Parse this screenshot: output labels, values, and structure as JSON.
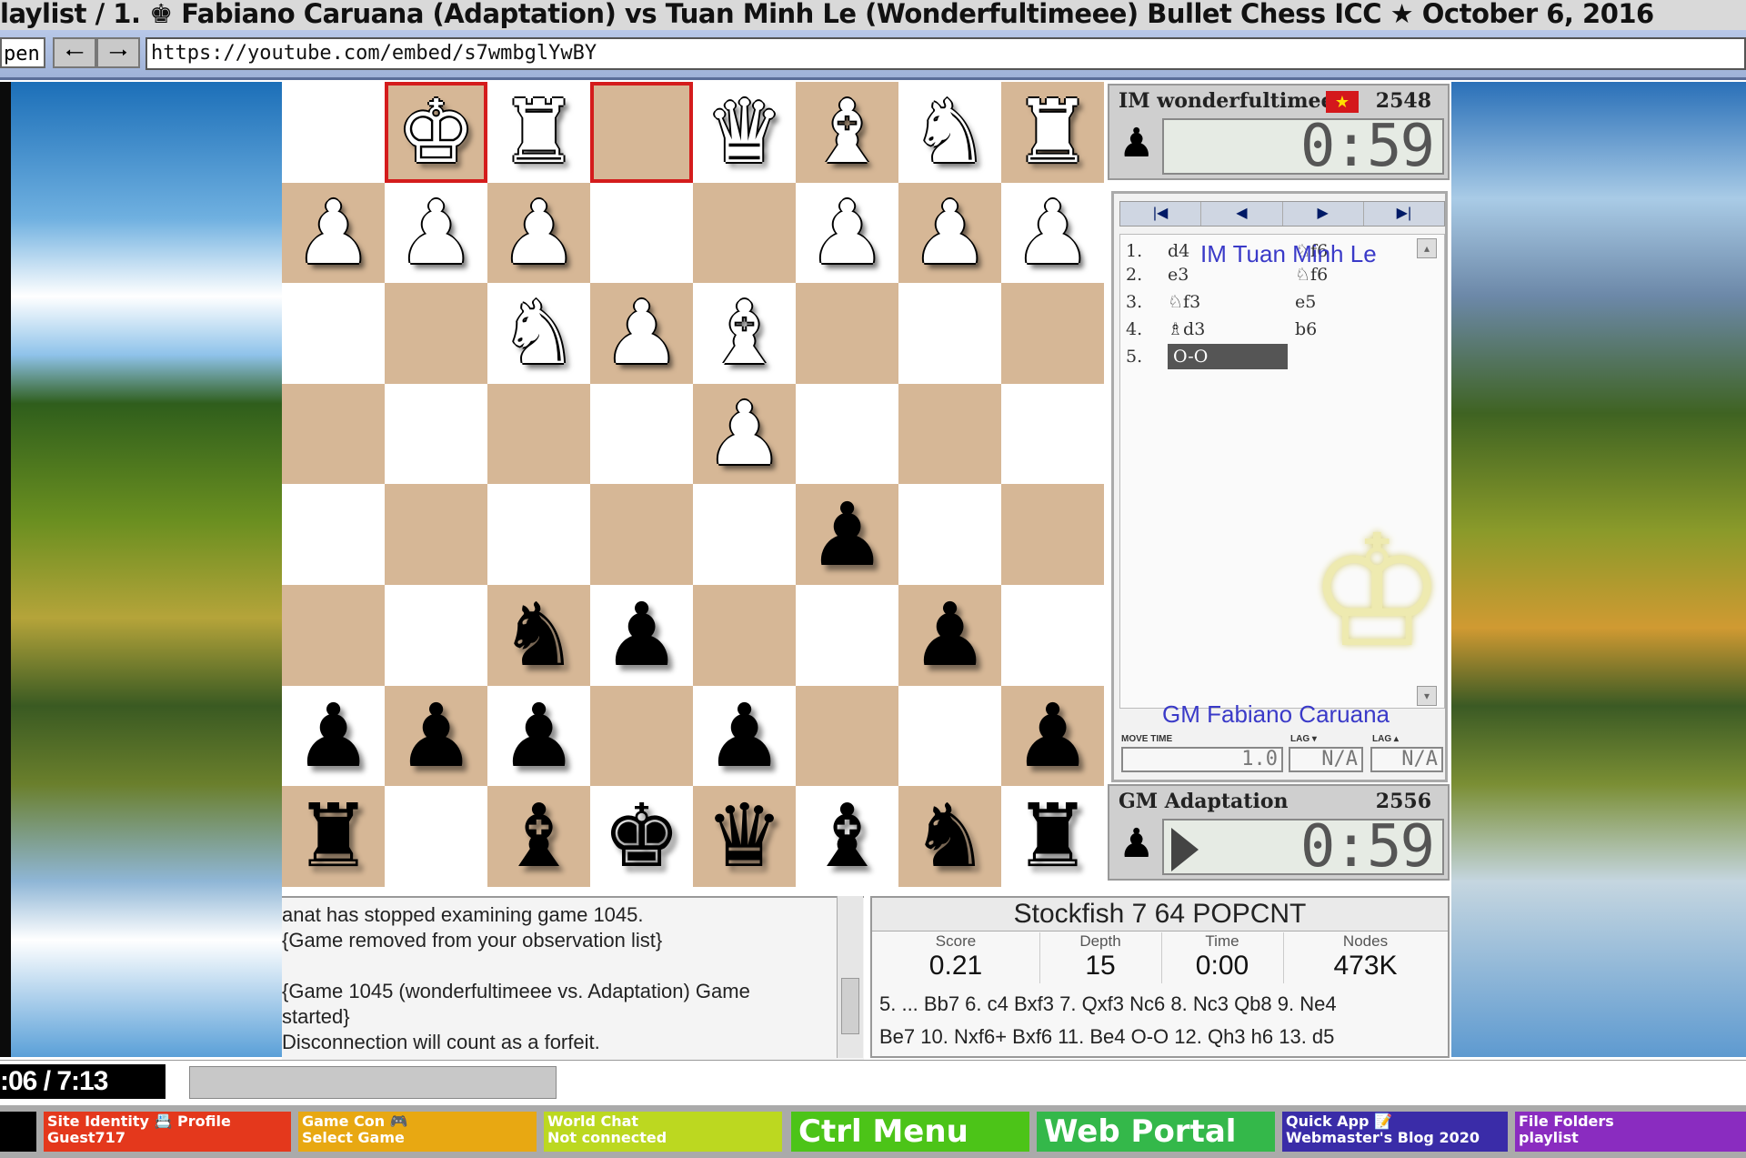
{
  "window": {
    "title": "laylist / 1. ♚ Fabiano Caruana (Adaptation) vs Tuan Minh Le (Wonderfultimeee) Bullet Chess ICC ★ October 6, 2016"
  },
  "address_bar": {
    "open_label": "pen",
    "back_icon": "arrow-left-icon",
    "forward_icon": "arrow-right-icon",
    "url": "https://youtube.com/embed/s7wmbglYwBY"
  },
  "board": {
    "light": "#ffffff",
    "dark": "#d6b796",
    "highlight": "#d41c1c",
    "highlighted_squares": [
      "b1",
      "d1"
    ],
    "pieces_by_row_top_to_bottom": [
      [
        "",
        "wK",
        "wR",
        "",
        "wQ",
        "wB",
        "wN",
        "wR"
      ],
      [
        "wP",
        "wP",
        "wP",
        "",
        "",
        "wP",
        "wP",
        "wP"
      ],
      [
        "",
        "",
        "wN",
        "wP",
        "wB",
        "",
        "",
        ""
      ],
      [
        "",
        "",
        "",
        "",
        "wP",
        "",
        "",
        ""
      ],
      [
        "",
        "",
        "",
        "",
        "",
        "bP",
        "",
        ""
      ],
      [
        "",
        "",
        "bN",
        "bP",
        "",
        "",
        "bP",
        ""
      ],
      [
        "bP",
        "bP",
        "bP",
        "",
        "bP",
        "",
        "",
        "bP"
      ],
      [
        "bR",
        "",
        "bB",
        "bK",
        "bQ",
        "bB",
        "bN",
        "bR"
      ]
    ]
  },
  "top_player": {
    "name": "IM wonderfultimeee",
    "rating": "2548",
    "clock": "0:59",
    "flag": "vietnam-flag"
  },
  "bottom_player": {
    "name": "GM Adaptation",
    "rating": "2556",
    "clock": "0:59"
  },
  "moves_panel": {
    "nav": [
      "|◀",
      "◀",
      "▶",
      "▶|"
    ],
    "top_label": "IM Tuan Minh Le",
    "bottom_label": "GM Fabiano Caruana",
    "moves": [
      {
        "num": "1.",
        "white": "d4",
        "black": "♘f6"
      },
      {
        "num": "2.",
        "white": "e3",
        "black": "♘f6"
      },
      {
        "num": "3.",
        "white": "♘f3",
        "black": "e5"
      },
      {
        "num": "4.",
        "white": "♗d3",
        "black": "b6"
      },
      {
        "num": "5.",
        "white": "O-O",
        "black": ""
      }
    ],
    "stats_labels": [
      "MOVE TIME",
      "LAG ▾",
      "LAG ▴"
    ],
    "stats_values": [
      "1.0",
      "N/A",
      "N/A"
    ]
  },
  "console": {
    "lines": [
      "anat has stopped examining game 1045.",
      "{Game removed from your observation list}",
      "",
      "{Game 1045 (wonderfultimeee vs. Adaptation) Game",
      "started}",
      "Disconnection will count as a forfeit."
    ]
  },
  "engine": {
    "title": "Stockfish 7 64 POPCNT",
    "headers": [
      "Score",
      "Depth",
      "Time",
      "Nodes"
    ],
    "values": [
      "0.21",
      "15",
      "0:00",
      "473K"
    ],
    "pv_line1": "5. ... Bb7 6. c4 Bxf3 7. Qxf3 Nc6 8. Nc3 Qb8 9. Ne4",
    "pv_line2": "Be7 10. Nxf6+ Bxf6 11. Be4 O-O 12. Qh3 h6 13. d5"
  },
  "video": {
    "time": ":06 / 7:13"
  },
  "taskbar": {
    "site": {
      "line1": "Site Identity 📇 Profile",
      "line2": "Guest717",
      "color": "#e4381c"
    },
    "game": {
      "line1": "Game Con 🎮",
      "line2": "Select Game",
      "color": "#e8a812"
    },
    "chat": {
      "line1": "World Chat",
      "line2": "Not connected",
      "color": "#bcd820"
    },
    "ctrl": {
      "label": "Ctrl  Menu",
      "color": "#4cc418"
    },
    "web": {
      "label": "Web Portal",
      "color": "#34b84a"
    },
    "quick": {
      "line1": "Quick App 📝",
      "line2": "Webmaster's Blog 2020",
      "color": "#3a2ca8"
    },
    "files": {
      "line1": "File Folders",
      "line2": "playlist",
      "color": "#8a2cc0"
    }
  }
}
